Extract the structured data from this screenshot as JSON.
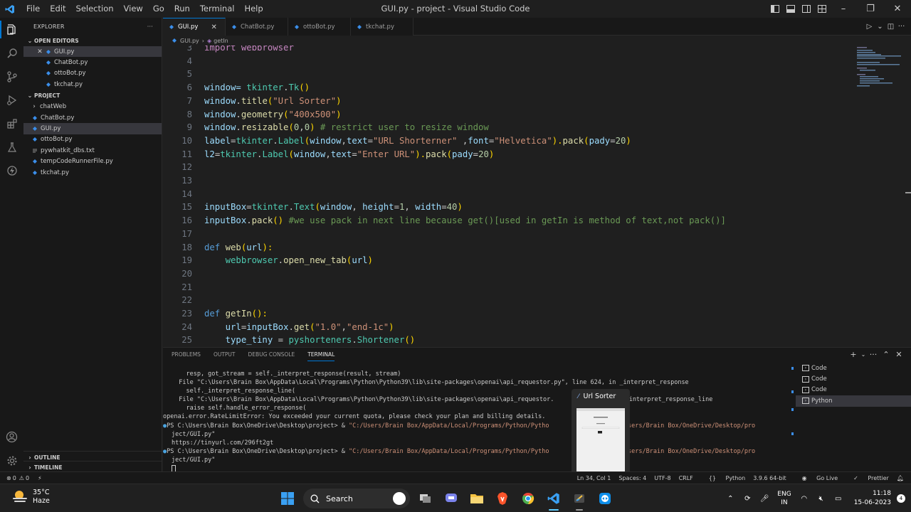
{
  "window": {
    "title": "GUI.py - project - Visual Studio Code",
    "menu": [
      "File",
      "Edit",
      "Selection",
      "View",
      "Go",
      "Run",
      "Terminal",
      "Help"
    ]
  },
  "explorer": {
    "title": "EXPLORER",
    "more": "···",
    "open_editors_label": "OPEN EDITORS",
    "open_editors": [
      "GUI.py",
      "ChatBot.py",
      "ottoBot.py",
      "tkchat.py"
    ],
    "project_label": "PROJECT",
    "project_items": [
      {
        "label": "chatWeb",
        "type": "folder"
      },
      {
        "label": "ChatBot.py",
        "type": "py"
      },
      {
        "label": "GUI.py",
        "type": "py"
      },
      {
        "label": "ottoBot.py",
        "type": "py"
      },
      {
        "label": "pywhatkit_dbs.txt",
        "type": "txt"
      },
      {
        "label": "tempCodeRunnerFile.py",
        "type": "py"
      },
      {
        "label": "tkchat.py",
        "type": "py"
      }
    ],
    "outline_label": "OUTLINE",
    "timeline_label": "TIMELINE"
  },
  "tabs": [
    {
      "label": "GUI.py",
      "active": true
    },
    {
      "label": "ChatBot.py",
      "active": false
    },
    {
      "label": "ottoBot.py",
      "active": false
    },
    {
      "label": "tkchat.py",
      "active": false
    }
  ],
  "breadcrumb": {
    "file": "GUI.py",
    "symbol": "getIn"
  },
  "code": {
    "line_numbers": [
      "3",
      "4",
      "5",
      "6",
      "7",
      "8",
      "9",
      "10",
      "11",
      "12",
      "13",
      "14",
      "15",
      "16",
      "17",
      "18",
      "19",
      "20",
      "21",
      "22",
      "23",
      "24",
      "25"
    ],
    "l3": "import webbrowser",
    "l6_a": "window= ",
    "l6_b": "tkinter",
    "l6_c": ".",
    "l6_d": "Tk",
    "l6_e": "()",
    "l7_a": "window",
    "l7_b": ".",
    "l7_c": "title",
    "l7_d": "(",
    "l7_e": "\"Url Sorter\"",
    "l7_f": ")",
    "l8_a": "window",
    "l8_b": ".",
    "l8_c": "geometry",
    "l8_d": "(",
    "l8_e": "\"400x500\"",
    "l8_f": ")",
    "l9_a": "window",
    "l9_b": ".",
    "l9_c": "resizable",
    "l9_d": "(",
    "l9_e": "0",
    "l9_f": ",",
    "l9_g": "0",
    "l9_h": ") ",
    "l9_i": "# restrict user to resize window",
    "l10_a": "label",
    "l10_b": "=",
    "l10_c": "tkinter",
    "l10_d": ".",
    "l10_e": "Label",
    "l10_f": "(",
    "l10_g": "window",
    "l10_h": ",",
    "l10_i": "text",
    "l10_j": "=",
    "l10_k": "\"URL Shorterner\"",
    "l10_l": " ,",
    "l10_m": "font",
    "l10_n": "=",
    "l10_o": "\"Helvetica\"",
    "l10_p": ").",
    "l10_q": "pack",
    "l10_r": "(",
    "l10_s": "pady",
    "l10_t": "=",
    "l10_u": "20",
    "l10_v": ")",
    "l11_a": "l2",
    "l11_b": "=",
    "l11_c": "tkinter",
    "l11_d": ".",
    "l11_e": "Label",
    "l11_f": "(",
    "l11_g": "window",
    "l11_h": ",",
    "l11_i": "text",
    "l11_j": "=",
    "l11_k": "\"Enter URL\"",
    "l11_l": ").",
    "l11_m": "pack",
    "l11_n": "(",
    "l11_o": "pady",
    "l11_p": "=",
    "l11_q": "20",
    "l11_r": ")",
    "l15_a": "inputBox",
    "l15_b": "=",
    "l15_c": "tkinter",
    "l15_d": ".",
    "l15_e": "Text",
    "l15_f": "(",
    "l15_g": "window",
    "l15_h": ", ",
    "l15_i": "height",
    "l15_j": "=",
    "l15_k": "1",
    "l15_l": ", ",
    "l15_m": "width",
    "l15_n": "=",
    "l15_o": "40",
    "l15_p": ")",
    "l16_a": "inputBox",
    "l16_b": ".",
    "l16_c": "pack",
    "l16_d": "() ",
    "l16_e": "#we use pack in next line because get()[used in getIn is method of text,not pack()]",
    "l18_a": "def ",
    "l18_b": "web",
    "l18_c": "(",
    "l18_d": "url",
    "l18_e": "):",
    "l19_a": "    webbrowser",
    "l19_b": ".",
    "l19_c": "open_new_tab",
    "l19_d": "(",
    "l19_e": "url",
    "l19_f": ")",
    "l23_a": "def ",
    "l23_b": "getIn",
    "l23_c": "():",
    "l24_a": "    url",
    "l24_b": "=",
    "l24_c": "inputBox",
    "l24_d": ".",
    "l24_e": "get",
    "l24_f": "(",
    "l24_g": "\"1.0\"",
    "l24_h": ",",
    "l24_i": "\"end-1c\"",
    "l24_j": ")",
    "l25_a": "    type_tiny",
    "l25_b": " = ",
    "l25_c": "pyshorteners",
    "l25_d": ".",
    "l25_e": "Shortener",
    "l25_f": "()"
  },
  "panel": {
    "tabs": [
      "PROBLEMS",
      "OUTPUT",
      "DEBUG CONSOLE",
      "TERMINAL"
    ],
    "terminal": {
      "t1": "    resp, got_stream = self._interpret_response(result, stream)",
      "t2": "  File \"C:\\Users\\Brain Box\\AppData\\Local\\Programs\\Python\\Python39\\lib\\site-packages\\openai\\api_requestor.py\", line 624, in _interpret_response",
      "t3": "    self._interpret_response_line(",
      "t4a": "  File \"C:\\Users\\Brain Box\\AppData\\Local\\Programs\\Python\\Python39\\lib\\site-packages\\openai\\api_requestor.",
      "t4b": "n _interpret_response_line",
      "t5": "    raise self.handle_error_response(",
      "t6": "openai.error.RateLimitError: You exceeded your current quota, please check your plan and billing details.",
      "t7a": "PS C:\\Users\\Brain Box\\OneDrive\\Desktop\\project> & ",
      "t7b": "\"C:/Users/Brain Box/AppData/Local/Programs/Python/Pytho",
      "t7c": "\"c:/Users/Brain Box/OneDrive/Desktop/pro",
      "t8": "ject/GUI.py\"",
      "t9": "https://tinyurl.com/296ft2gt",
      "t10a": "PS C:\\Users\\Brain Box\\OneDrive\\Desktop\\project> & ",
      "t10b": "\"C:/Users/Brain Box/AppData/Local/Programs/Python/Pytho",
      "t10c": "\"c:/Users/Brain Box/OneDrive/Desktop/pro",
      "t11": "ject/GUI.py\""
    },
    "terminal_list": [
      "Code",
      "Code",
      "Code",
      "Python"
    ]
  },
  "preview": {
    "title": "Url Sorter"
  },
  "statusbar": {
    "errors": "0",
    "warnings": "0",
    "position": "Ln 34, Col 1",
    "spaces": "Spaces: 4",
    "encoding": "UTF-8",
    "eol": "CRLF",
    "language": "Python",
    "interpreter": "3.9.6 64-bit",
    "golive": "Go Live",
    "prettier": "Prettier"
  },
  "taskbar": {
    "temp": "35°C",
    "weather": "Haze",
    "search": "Search",
    "lang1": "ENG",
    "lang2": "IN",
    "time": "11:18",
    "date": "15-06-2023",
    "badge": "4"
  },
  "colors": {
    "accent": "#0078d4",
    "bg": "#1e1e1e"
  }
}
